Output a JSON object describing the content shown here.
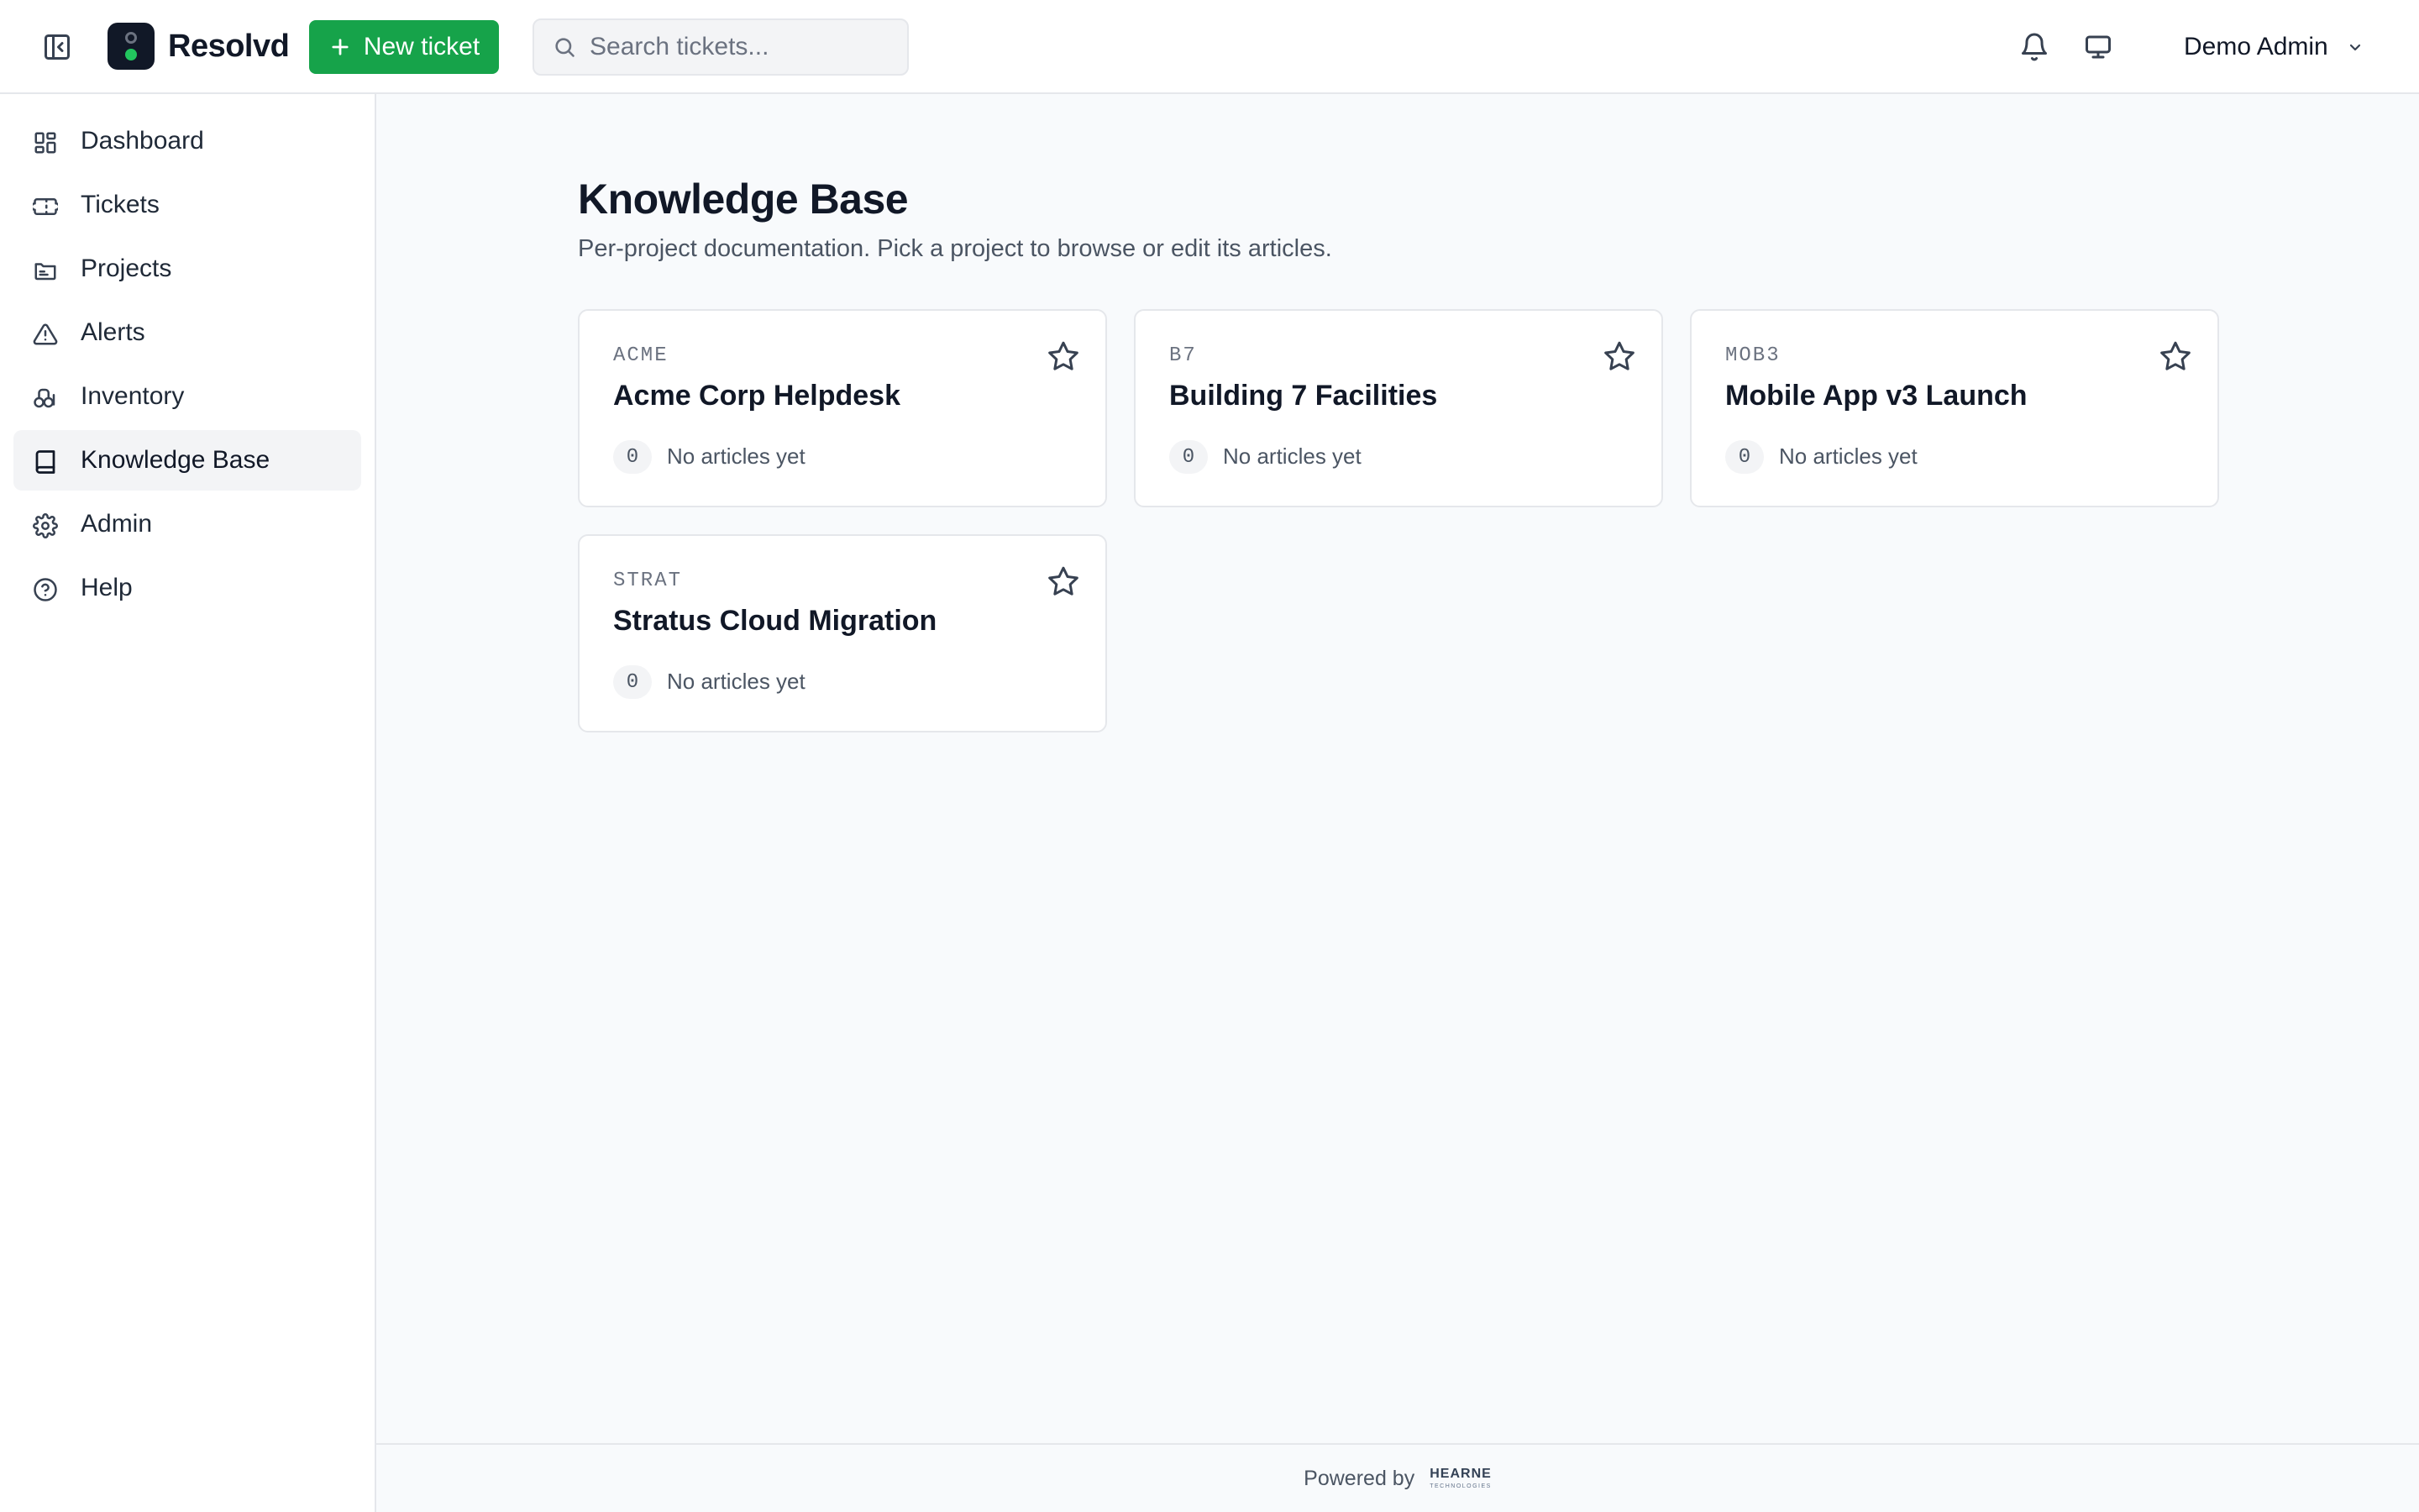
{
  "app": {
    "brand_name": "Resolvd",
    "logo_icon": "traffic-light-logo"
  },
  "header": {
    "new_ticket_label": "New ticket",
    "search_placeholder": "Search tickets...",
    "notifications_icon": "bell-icon",
    "display_icon": "monitor-icon",
    "user_name": "Demo Admin"
  },
  "sidebar": {
    "items": [
      {
        "label": "Dashboard",
        "icon": "dashboard-icon",
        "active": false
      },
      {
        "label": "Tickets",
        "icon": "ticket-icon",
        "active": false
      },
      {
        "label": "Projects",
        "icon": "folder-icon",
        "active": false
      },
      {
        "label": "Alerts",
        "icon": "alert-triangle-icon",
        "active": false
      },
      {
        "label": "Inventory",
        "icon": "inventory-icon",
        "active": false
      },
      {
        "label": "Knowledge Base",
        "icon": "book-icon",
        "active": true
      },
      {
        "label": "Admin",
        "icon": "gear-icon",
        "active": false
      },
      {
        "label": "Help",
        "icon": "help-circle-icon",
        "active": false
      }
    ]
  },
  "main": {
    "title": "Knowledge Base",
    "subtitle": "Per-project documentation. Pick a project to browse or edit its articles.",
    "projects": [
      {
        "key": "ACME",
        "name": "Acme Corp Helpdesk",
        "count": "0",
        "count_label": "No articles yet"
      },
      {
        "key": "B7",
        "name": "Building 7 Facilities",
        "count": "0",
        "count_label": "No articles yet"
      },
      {
        "key": "MOB3",
        "name": "Mobile App v3 Launch",
        "count": "0",
        "count_label": "No articles yet"
      },
      {
        "key": "STRAT",
        "name": "Stratus Cloud Migration",
        "count": "0",
        "count_label": "No articles yet"
      }
    ]
  },
  "footer": {
    "powered_by": "Powered by",
    "logo_main": "HEARNE",
    "logo_sub": "TECHNOLOGIES"
  },
  "colors": {
    "primary_green": "#16a34a",
    "logo_bg": "#111827",
    "active_nav_bg": "#f3f4f6",
    "main_bg": "#f8fafc"
  }
}
